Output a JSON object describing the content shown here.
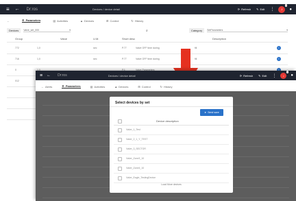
{
  "back_window": {
    "logo": "Dr:ros",
    "breadcrumb": "Devices / device detail",
    "header_actions": [
      "Refresh",
      "Edit"
    ],
    "notification_count": "1",
    "tabs": [
      {
        "label": "Parameters",
        "active": true
      },
      {
        "label": "Activities",
        "active": false
      },
      {
        "label": "Devices",
        "active": false
      },
      {
        "label": "Control",
        "active": false
      },
      {
        "label": "History",
        "active": false
      }
    ],
    "filter": {
      "label": "Devices",
      "value": "Valve_set_000",
      "category_label": "Category",
      "category_value": "SetParameters"
    },
    "columns": [
      "Group",
      "Value",
      "U.M.",
      "Short desc",
      "Description"
    ],
    "rows": [
      {
        "group": "772",
        "value": "1,0",
        "um": "sec",
        "short": "P.77",
        "short_desc": "Valve OFF time during",
        "desc": "fill"
      },
      {
        "group": "716",
        "value": "1,0",
        "um": "sec",
        "short": "P.77",
        "short_desc": "Valve OFF time during",
        "desc": "fill"
      },
      {
        "group": "0",
        "value": "1,0",
        "um": "",
        "short": "P.1",
        "short_desc": "Valve Parameters",
        "desc": ""
      },
      {
        "group": "012",
        "value": "",
        "um": "",
        "short": "",
        "short_desc": "",
        "desc": ""
      },
      {
        "group": "",
        "value": "",
        "um": "",
        "short": "",
        "short_desc": "",
        "desc": ""
      },
      {
        "group": "",
        "value": "",
        "um": "",
        "short": "",
        "short_desc": "",
        "desc": ""
      },
      {
        "group": "",
        "value": "",
        "um": "",
        "short": "",
        "short_desc": "",
        "desc": ""
      }
    ]
  },
  "front_window": {
    "logo": "Dr:ros",
    "breadcrumb": "Devices / device detail",
    "header_actions": [
      "Refresh",
      "Edit"
    ],
    "notification_count": "1",
    "tabs": [
      {
        "label": "Alerts",
        "active": false
      },
      {
        "label": "Parameters",
        "active": true
      },
      {
        "label": "Activities",
        "active": false
      },
      {
        "label": "Devices",
        "active": false
      },
      {
        "label": "Control",
        "active": false
      },
      {
        "label": "History",
        "active": false
      }
    ]
  },
  "modal": {
    "title": "Select devices by set",
    "primary_button": "Send save",
    "column_header": "Device description",
    "items": [
      "Valve_1_Test",
      "Valve_2_1_Y_TEST",
      "Valve_3_SECTOR",
      "Valve_Zone3_10",
      "Valve_Zone4_10",
      "Valve_Eagle_TestingDevice"
    ],
    "footer_link": "Load More devices"
  },
  "colors": {
    "header": "#1f2430",
    "accent": "#2a72c9",
    "badge": "#e53935",
    "arrow": "#e53120"
  }
}
